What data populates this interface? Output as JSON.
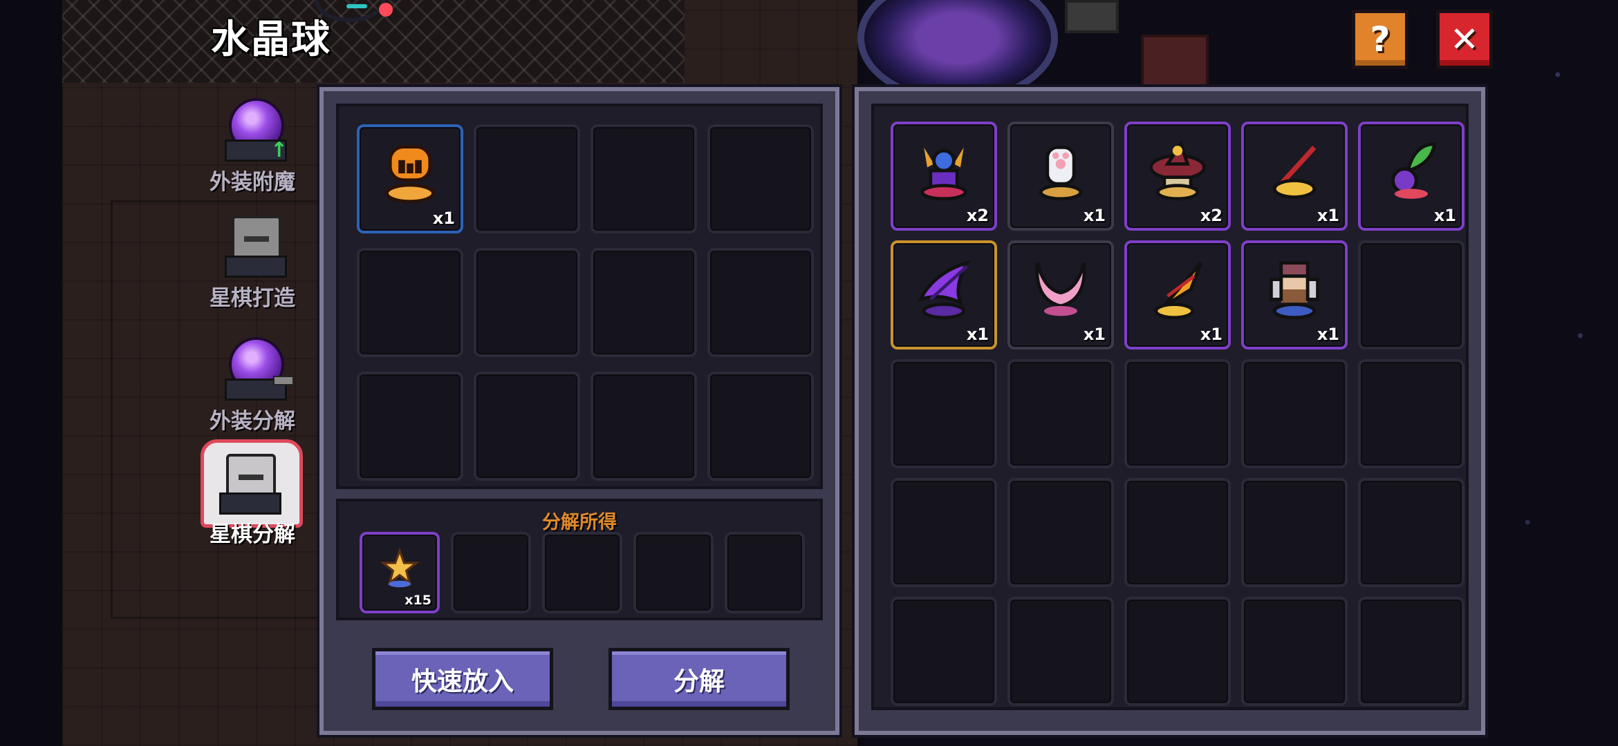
{
  "title": "水晶球",
  "header": {
    "help_icon": "question-mark-icon",
    "help_label": "?",
    "close_icon": "close-x-icon",
    "close_label": "✕"
  },
  "colors": {
    "panel_bg": "#3b3a4e",
    "panel_border": "#7d7a98",
    "accent_orange": "#e08a2c",
    "button_purple": "#6a63b8",
    "help_button": "#e0832a",
    "close_button": "#d8262e",
    "active_tab_border": "#e0485a"
  },
  "sidebar": {
    "items": [
      {
        "label": "外装附魔",
        "icon": "purple-orb-enchant-icon",
        "active": false
      },
      {
        "label": "星棋打造",
        "icon": "chess-piece-forge-icon",
        "active": false
      },
      {
        "label": "外装分解",
        "icon": "purple-orb-dismantle-icon",
        "active": false
      },
      {
        "label": "星棋分解",
        "icon": "chess-piece-dismantle-icon",
        "active": true
      }
    ]
  },
  "input_slots": [
    {
      "item": "orange-skull-helmet-icon",
      "count": "x1",
      "rarity": "blue"
    },
    {
      "item": null,
      "count": ""
    },
    {
      "item": null,
      "count": ""
    },
    {
      "item": null,
      "count": ""
    },
    {
      "item": null,
      "count": ""
    },
    {
      "item": null,
      "count": ""
    },
    {
      "item": null,
      "count": ""
    },
    {
      "item": null,
      "count": ""
    },
    {
      "item": null,
      "count": ""
    },
    {
      "item": null,
      "count": ""
    },
    {
      "item": null,
      "count": ""
    },
    {
      "item": null,
      "count": ""
    }
  ],
  "result": {
    "label": "分解所得",
    "slots": [
      {
        "item": "star-shard-icon",
        "count": "x15",
        "rarity": "purple"
      },
      {
        "item": null,
        "count": ""
      },
      {
        "item": null,
        "count": ""
      },
      {
        "item": null,
        "count": ""
      },
      {
        "item": null,
        "count": ""
      }
    ]
  },
  "buttons": {
    "quick_add": "快速放入",
    "dismantle": "分解"
  },
  "inventory": [
    {
      "item": "demon-horn-chess-piece-icon",
      "count": "x2",
      "rarity": "purple"
    },
    {
      "item": "white-paw-chess-piece-icon",
      "count": "x1",
      "rarity": "grey"
    },
    {
      "item": "witch-hat-chess-piece-icon",
      "count": "x2",
      "rarity": "purple"
    },
    {
      "item": "red-wand-chess-piece-icon",
      "count": "x1",
      "rarity": "purple"
    },
    {
      "item": "leaf-berry-chess-piece-icon",
      "count": "x1",
      "rarity": "purple"
    },
    {
      "item": "purple-flame-sword-icon",
      "count": "x1",
      "rarity": "gold"
    },
    {
      "item": "pink-wings-chess-piece-icon",
      "count": "x1",
      "rarity": "grey"
    },
    {
      "item": "golden-lance-chess-piece-icon",
      "count": "x1",
      "rarity": "purple"
    },
    {
      "item": "bearded-knight-chess-piece-icon",
      "count": "x1",
      "rarity": "purple"
    },
    {
      "item": null,
      "count": ""
    },
    {
      "item": null,
      "count": ""
    },
    {
      "item": null,
      "count": ""
    },
    {
      "item": null,
      "count": ""
    },
    {
      "item": null,
      "count": ""
    },
    {
      "item": null,
      "count": ""
    },
    {
      "item": null,
      "count": ""
    },
    {
      "item": null,
      "count": ""
    },
    {
      "item": null,
      "count": ""
    },
    {
      "item": null,
      "count": ""
    },
    {
      "item": null,
      "count": ""
    },
    {
      "item": null,
      "count": ""
    },
    {
      "item": null,
      "count": ""
    },
    {
      "item": null,
      "count": ""
    },
    {
      "item": null,
      "count": ""
    },
    {
      "item": null,
      "count": ""
    }
  ]
}
